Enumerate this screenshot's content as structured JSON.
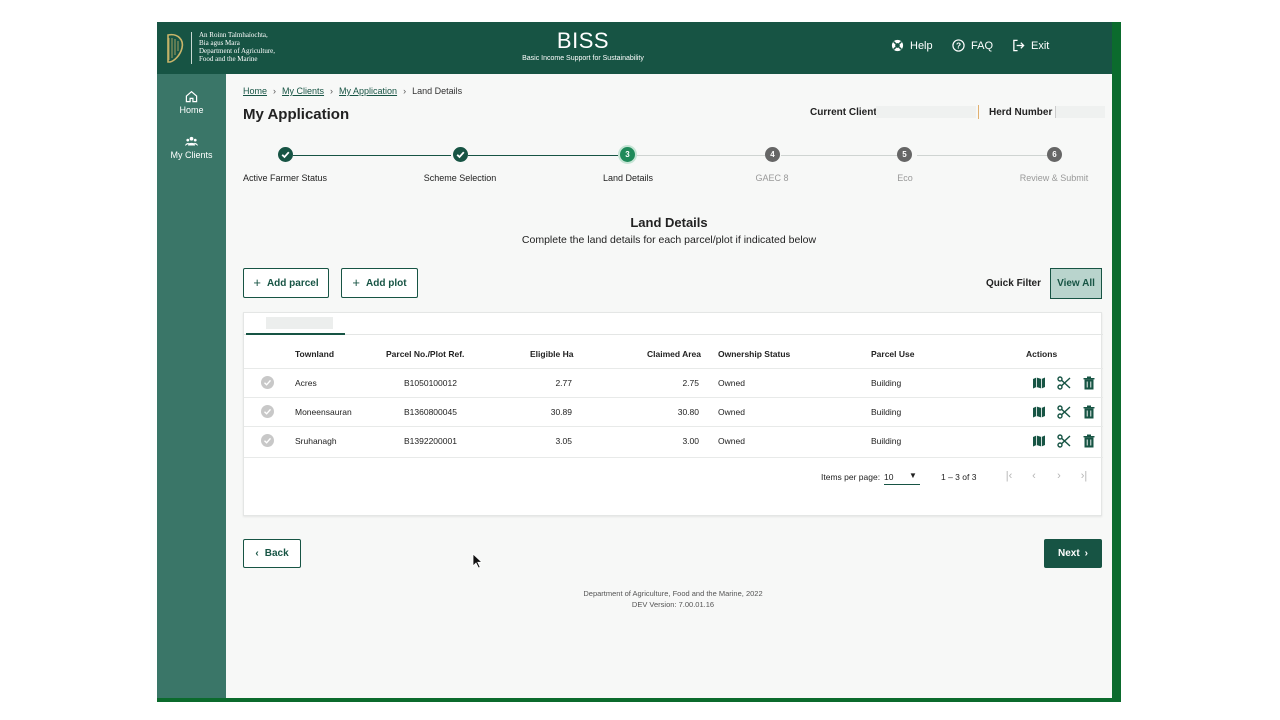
{
  "header": {
    "dept_lines": [
      "An Roinn Talmhaíochta,",
      "Bia agus Mara",
      "Department of Agriculture,",
      "Food and the Marine"
    ],
    "app_title": "BISS",
    "app_subtitle": "Basic Income Support for Sustainability",
    "help": "Help",
    "faq": "FAQ",
    "exit": "Exit"
  },
  "sidenav": {
    "home": "Home",
    "clients": "My Clients"
  },
  "breadcrumb": {
    "home": "Home",
    "clients": "My Clients",
    "application": "My Application",
    "current": "Land Details"
  },
  "page_title": "My Application",
  "client": {
    "current_client_label": "Current Client",
    "herd_number_label": "Herd Number"
  },
  "stepper": {
    "steps": [
      {
        "number": "1",
        "label": "Active Farmer Status",
        "state": "done"
      },
      {
        "number": "2",
        "label": "Scheme Selection",
        "state": "done"
      },
      {
        "number": "3",
        "label": "Land Details",
        "state": "active"
      },
      {
        "number": "4",
        "label": "GAEC 8",
        "state": "pending"
      },
      {
        "number": "5",
        "label": "Eco",
        "state": "pending"
      },
      {
        "number": "6",
        "label": "Review & Submit",
        "state": "pending"
      }
    ]
  },
  "section": {
    "title": "Land Details",
    "subtitle": "Complete the land details for each parcel/plot if indicated below"
  },
  "actions": {
    "add_parcel": "Add parcel",
    "add_plot": "Add plot",
    "quick_filter": "Quick Filter",
    "view_all": "View All"
  },
  "table": {
    "columns": [
      "Townland",
      "Parcel No./Plot Ref.",
      "Eligible Ha",
      "Claimed Area",
      "Ownership Status",
      "Parcel Use",
      "Actions"
    ],
    "rows": [
      {
        "townland": "Acres",
        "parcel": "B1050100012",
        "eligible": "2.77",
        "claimed": "2.75",
        "ownership": "Owned",
        "use": "Building"
      },
      {
        "townland": "Moneensauran",
        "parcel": "B1360800045",
        "eligible": "30.89",
        "claimed": "30.80",
        "ownership": "Owned",
        "use": "Building"
      },
      {
        "townland": "Sruhanagh",
        "parcel": "B1392200001",
        "eligible": "3.05",
        "claimed": "3.00",
        "ownership": "Owned",
        "use": "Building"
      }
    ]
  },
  "pager": {
    "items_per_page_label": "Items per page:",
    "items_per_page": "10",
    "range": "1 – 3 of 3"
  },
  "nav": {
    "back": "Back",
    "next": "Next"
  },
  "footer": {
    "line1": "Department of Agriculture, Food and the Marine, 2022",
    "line2": "DEV Version: 7.00.01.16"
  },
  "colors": {
    "primary": "#175444",
    "sidebar": "#3a7668",
    "active_step": "#1f8a5a",
    "pending_step": "#666666",
    "frame": "#0b6b2d"
  }
}
